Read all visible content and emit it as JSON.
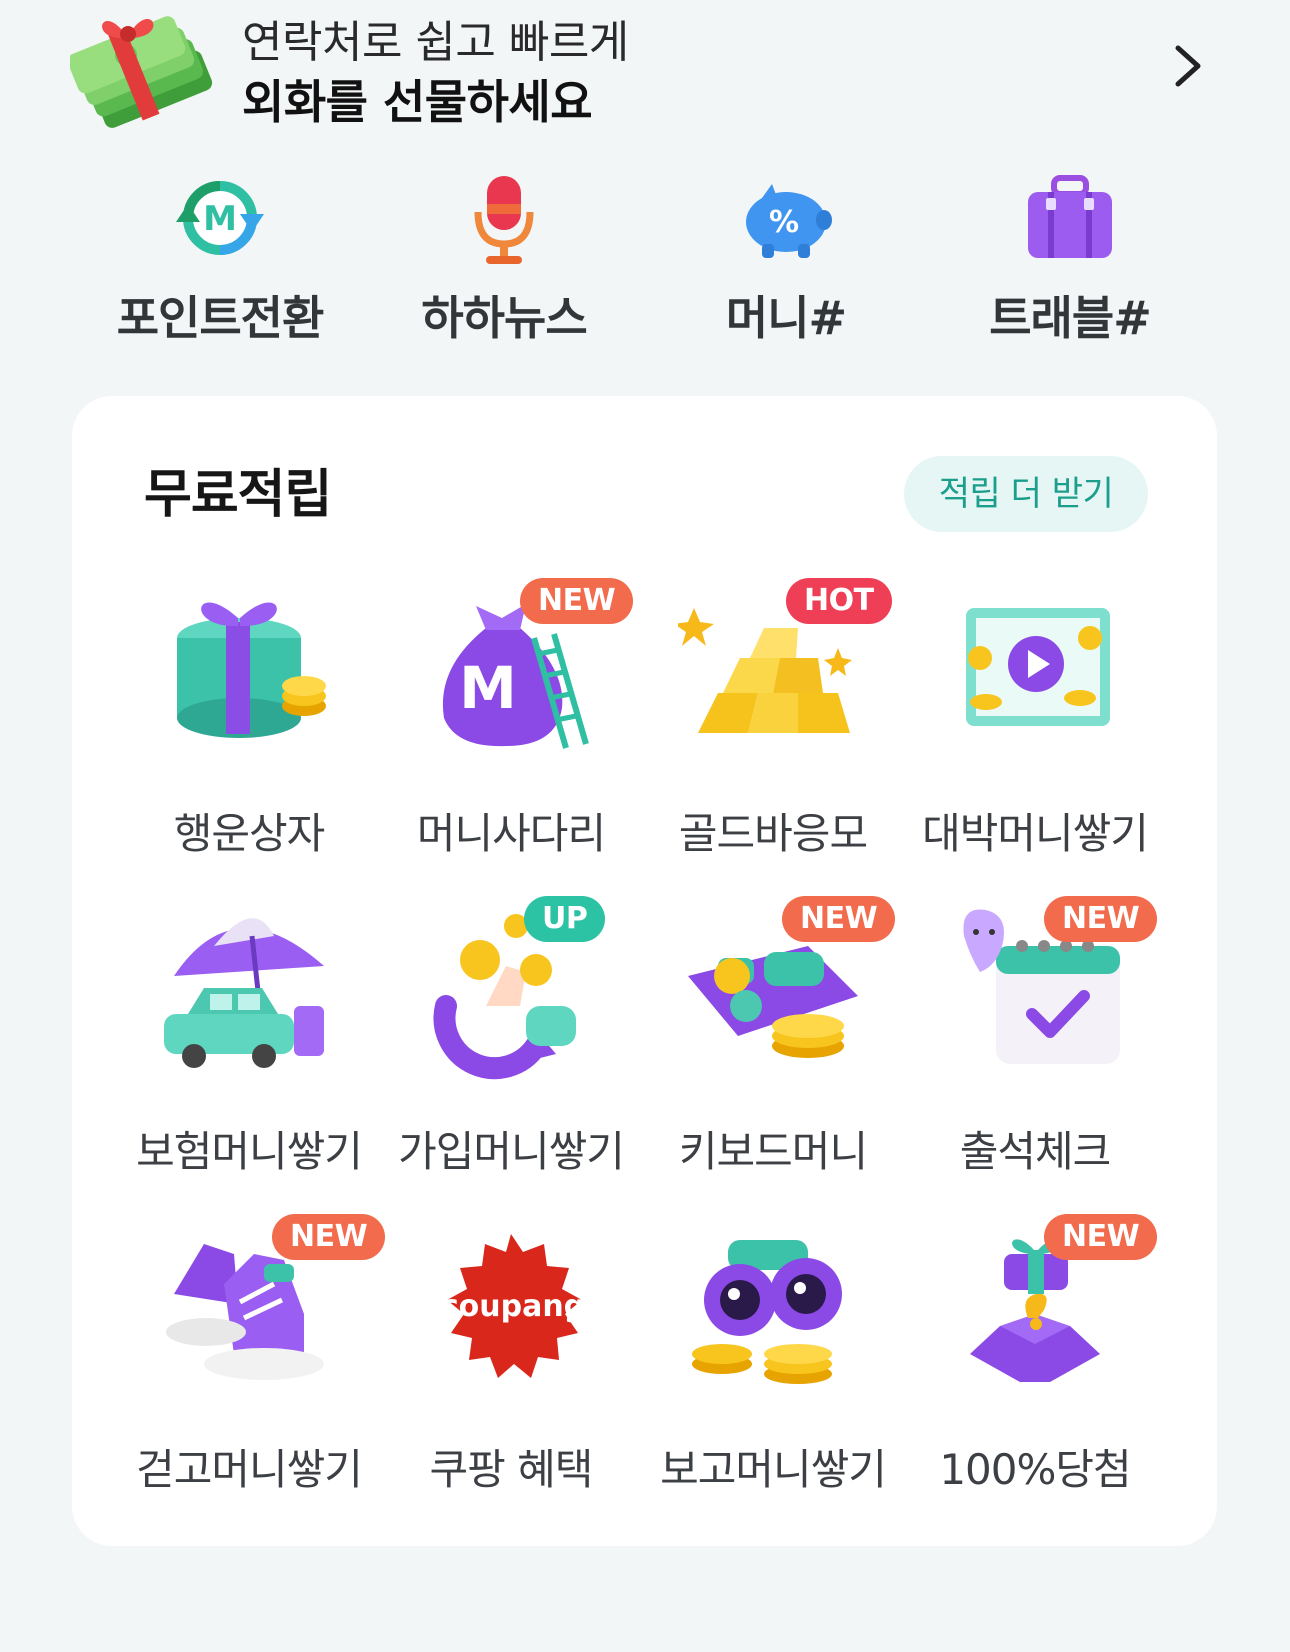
{
  "promo": {
    "line1": "연락처로 쉽고 빠르게",
    "line2": "외화를 선물하세요"
  },
  "quick_menu": [
    {
      "label": "포인트전환",
      "icon": "point-exchange-icon"
    },
    {
      "label": "하하뉴스",
      "icon": "microphone-icon"
    },
    {
      "label": "머니#",
      "icon": "piggy-bank-icon"
    },
    {
      "label": "트래블#",
      "icon": "suitcase-icon"
    }
  ],
  "free_points": {
    "title": "무료적립",
    "more_button": "적립 더 받기",
    "items": [
      {
        "label": "행운상자",
        "badge": "",
        "icon": "gift-box-icon"
      },
      {
        "label": "머니사다리",
        "badge": "NEW",
        "icon": "money-bag-ladder-icon"
      },
      {
        "label": "골드바응모",
        "badge": "HOT",
        "icon": "gold-bars-icon"
      },
      {
        "label": "대박머니쌓기",
        "badge": "",
        "icon": "video-play-icon"
      },
      {
        "label": "보험머니쌓기",
        "badge": "",
        "icon": "umbrella-car-icon"
      },
      {
        "label": "가입머니쌓기",
        "badge": "UP",
        "icon": "hand-coins-icon"
      },
      {
        "label": "키보드머니",
        "badge": "NEW",
        "icon": "keyboard-coins-icon"
      },
      {
        "label": "출석체크",
        "badge": "NEW",
        "icon": "calendar-check-icon"
      },
      {
        "label": "걷고머니쌓기",
        "badge": "NEW",
        "icon": "sneakers-icon"
      },
      {
        "label": "쿠팡 혜택",
        "badge": "",
        "icon": "coupang-logo-icon",
        "logo_text": "coupang"
      },
      {
        "label": "보고머니쌓기",
        "badge": "",
        "icon": "binoculars-icon"
      },
      {
        "label": "100%당첨",
        "badge": "NEW",
        "icon": "prize-box-icon"
      }
    ]
  },
  "colors": {
    "background": "#f3f6f7",
    "card": "#ffffff",
    "accent_teal": "#1b9e8c",
    "badge_new": "#f26b4c",
    "badge_hot": "#ef3f56",
    "badge_up": "#2cc2a4"
  }
}
